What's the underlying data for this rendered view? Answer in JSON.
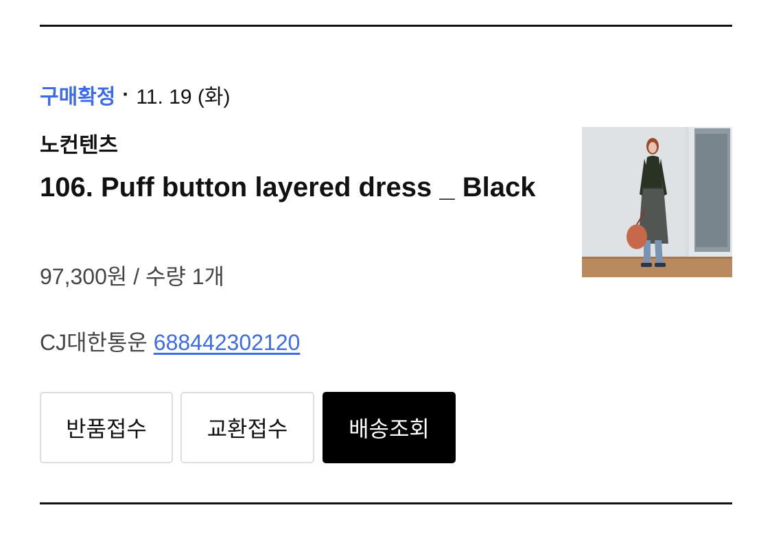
{
  "order": {
    "status": "구매확정",
    "separator": "·",
    "date": "11. 19 (화)",
    "brand": "노컨텐츠",
    "product_name": "106. Puff button layered dress _ Black",
    "price_quantity": "97,300원 / 수량 1개",
    "courier": "CJ대한통운",
    "tracking_number": "688442302120",
    "image_icon": "product-photo-dress-model"
  },
  "actions": {
    "return_label": "반품접수",
    "exchange_label": "교환접수",
    "track_label": "배송조회"
  },
  "colors": {
    "status": "#3d6ae8",
    "link": "#3d6ae8",
    "primary_button": "#000000",
    "divider": "#111111"
  }
}
